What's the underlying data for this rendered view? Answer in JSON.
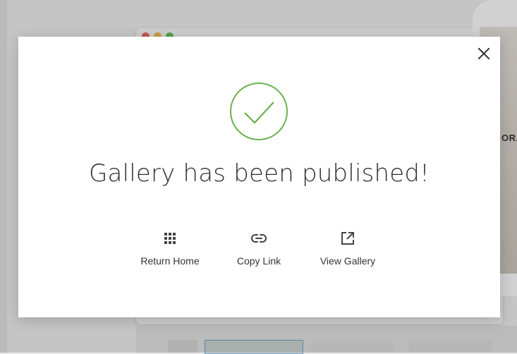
{
  "background": {
    "photo_text": "ORA",
    "traffic_lights": [
      "#ec6a5e",
      "#f4bf4f",
      "#61c554"
    ]
  },
  "modal": {
    "title": "Gallery has been published!",
    "success_color": "#6ab04c",
    "actions": [
      {
        "label": "Return Home",
        "icon": "apps-grid-icon"
      },
      {
        "label": "Copy Link",
        "icon": "link-icon"
      },
      {
        "label": "View Gallery",
        "icon": "open-external-icon"
      }
    ]
  }
}
